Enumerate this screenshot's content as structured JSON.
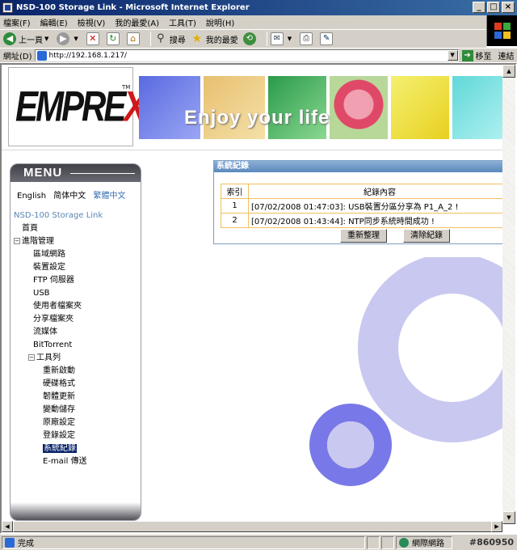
{
  "window": {
    "title": "NSD-100 Storage Link - Microsoft Internet Explorer"
  },
  "menubar": {
    "items": [
      "檔案(F)",
      "編輯(E)",
      "檢視(V)",
      "我的最愛(A)",
      "工具(T)",
      "說明(H)"
    ]
  },
  "toolbar": {
    "back_label": "上一頁",
    "search_label": "搜尋",
    "favorites_label": "我的最愛"
  },
  "address": {
    "label": "網址(D)",
    "url": "http://192.168.1.217/",
    "go_label": "移至",
    "links_label": "連結"
  },
  "header": {
    "logo_text_a": "EMPRE",
    "logo_text_b": "X",
    "logo_tm": "TM",
    "banner_text": "Enjoy your life"
  },
  "sidebar": {
    "menu_title": "MENU",
    "languages": [
      "English",
      "简体中文",
      "繁體中文"
    ],
    "root": "NSD-100 Storage Link",
    "items": {
      "home": "首頁",
      "advanced": "進階管理",
      "lan": "區域網路",
      "device": "裝置設定",
      "ftp": "FTP 伺服器",
      "usb": "USB",
      "user_folder": "使用者檔案夾",
      "share_folder": "分享檔案夾",
      "streaming": "流媒体",
      "bittorrent": "BitTorrent",
      "tools": "工具列",
      "restart": "重新啟動",
      "format": "硬碟格式",
      "firmware": "韌體更新",
      "save": "變動儲存",
      "factory": "原廠設定",
      "login": "登錄設定",
      "syslog": "系統紀錄",
      "email": "E-mail 傳送"
    }
  },
  "log": {
    "title": "系統紀錄",
    "col_index": "索引",
    "col_content": "紀錄內容",
    "rows": [
      {
        "index": "1",
        "text": "[07/02/2008 01:47:03]: USB裝置分區分享為 P1_A_2 !"
      },
      {
        "index": "2",
        "text": "[07/02/2008 01:43:44]: NTP同步系統時間成功 !"
      }
    ],
    "refresh_label": "重新整理",
    "clear_label": "清除紀錄"
  },
  "status": {
    "text": "完成",
    "zone": "網際網路",
    "watermark": "#860950"
  },
  "colors": {
    "title_bar": "#0a246a",
    "panel_title": "#5a88bc",
    "selected": "#0a246a",
    "table_border": "#f0c060",
    "ring_light": "#c8c8f0",
    "ring_dark": "#7878e8"
  }
}
